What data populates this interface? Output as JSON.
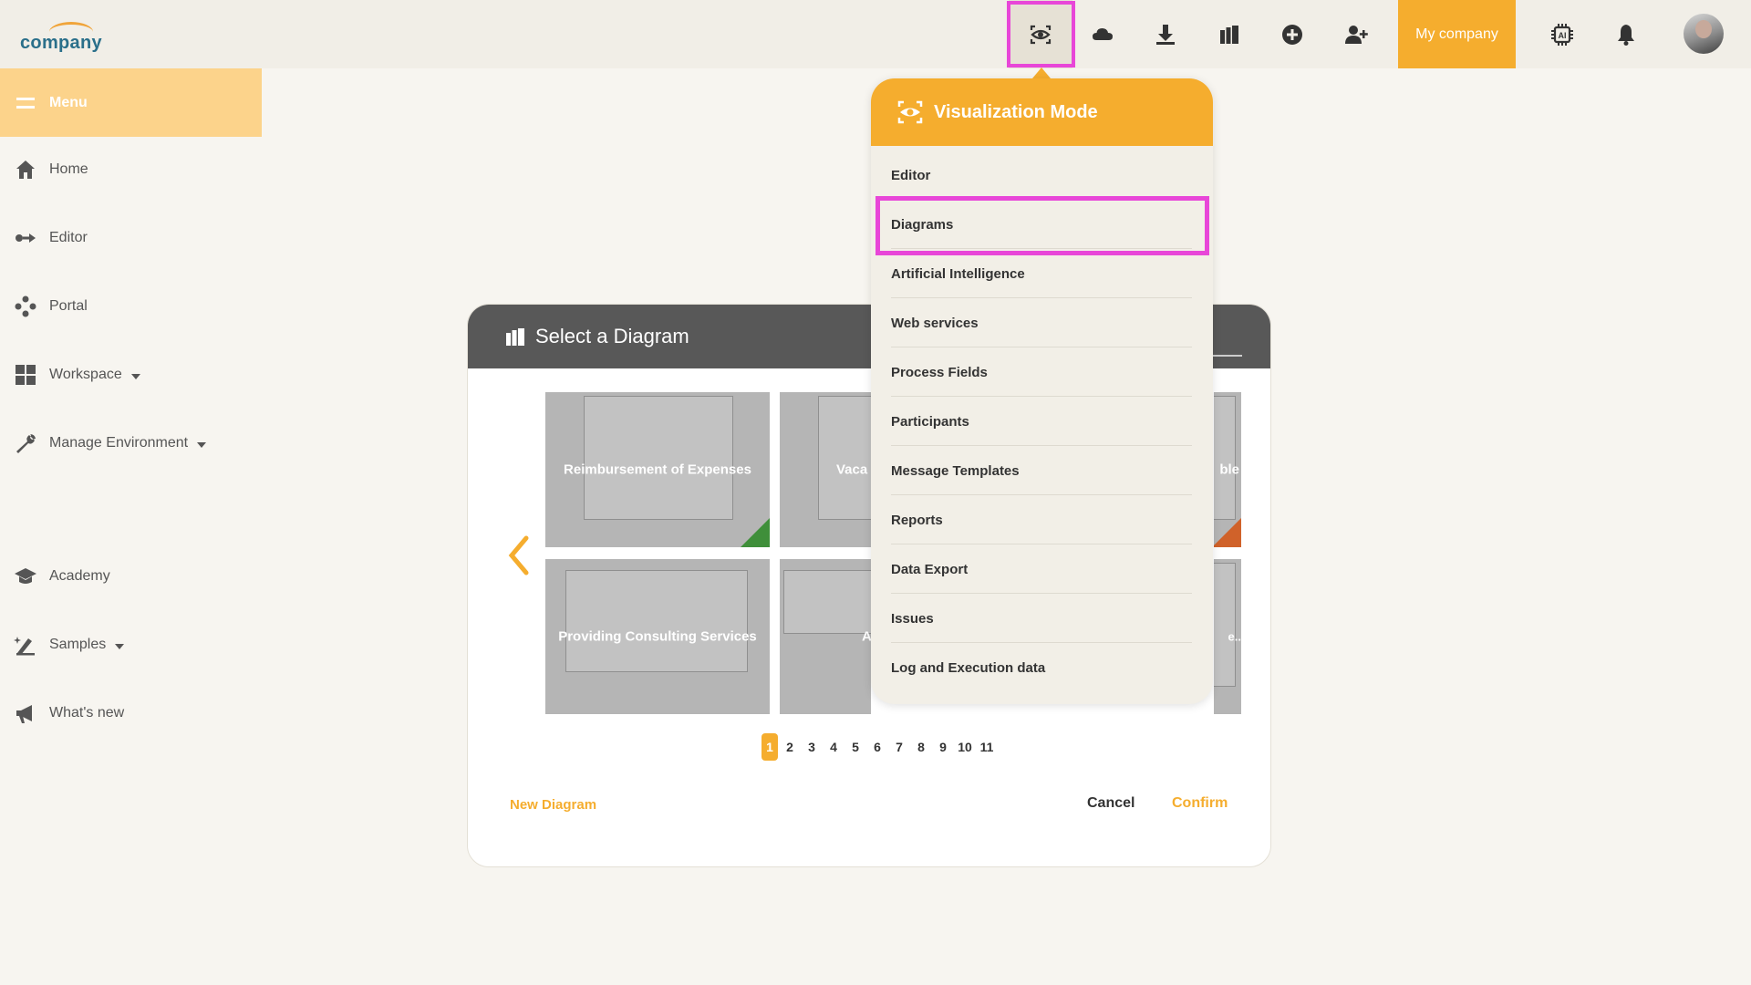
{
  "header": {
    "logo_text": "company",
    "company_button": "My company",
    "icons": [
      "eye-icon",
      "cloud-icon",
      "download-icon",
      "library-icon",
      "plus-circle-icon",
      "add-user-icon",
      "ai-chip-icon",
      "bell-icon"
    ]
  },
  "sidebar": {
    "menu_label": "Menu",
    "items": [
      {
        "label": "Home",
        "icon": "home-icon"
      },
      {
        "label": "Editor",
        "icon": "editor-icon"
      },
      {
        "label": "Portal",
        "icon": "portal-icon"
      },
      {
        "label": "Workspace",
        "icon": "grid-icon"
      },
      {
        "label": "Manage Environment",
        "icon": "wrench-icon"
      },
      {
        "label": "Academy",
        "icon": "graduation-cap-icon"
      },
      {
        "label": "Samples",
        "icon": "samples-icon"
      },
      {
        "label": "What's new",
        "icon": "megaphone-icon"
      }
    ]
  },
  "dialog": {
    "title": "Select a Diagram",
    "thumbnails": [
      {
        "label": "Reimbursement of Expenses"
      },
      {
        "label": "Vaca"
      },
      {
        "label": "ble"
      },
      {
        "label": "Providing Consulting Services"
      },
      {
        "label": "A"
      },
      {
        "label": "e.."
      }
    ],
    "pages": [
      "1",
      "2",
      "3",
      "4",
      "5",
      "6",
      "7",
      "8",
      "9",
      "10",
      "11"
    ],
    "current_page": "1",
    "new_diagram": "New Diagram",
    "cancel": "Cancel",
    "confirm": "Confirm"
  },
  "visualization_menu": {
    "title": "Visualization Mode",
    "items": [
      "Editor",
      "Diagrams",
      "Artificial Intelligence",
      "Web services",
      "Process Fields",
      "Participants",
      "Message Templates",
      "Reports",
      "Data Export",
      "Issues",
      "Log and Execution data"
    ],
    "highlighted": "Diagrams"
  },
  "colors": {
    "accent": "#f5ad2e",
    "highlight_box": "#e846d8",
    "menu_bg": "#fcd38b",
    "dialog_header": "#585858",
    "corner_green": "#3f8f3a",
    "corner_orange": "#d0622a"
  }
}
